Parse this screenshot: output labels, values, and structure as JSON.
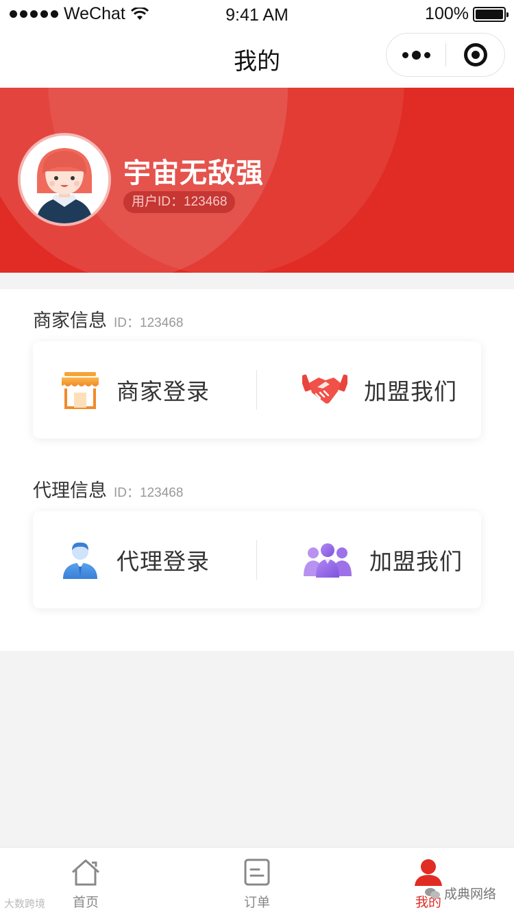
{
  "status_bar": {
    "carrier": "WeChat",
    "time": "9:41 AM",
    "battery": "100%"
  },
  "nav": {
    "title": "我的"
  },
  "profile": {
    "name": "宇宙无敌强",
    "user_id": "用户ID：123468"
  },
  "merchant_section": {
    "title": "商家信息",
    "id_text": "ID：123468",
    "login_label": "商家登录",
    "join_label": "加盟我们"
  },
  "agent_section": {
    "title": "代理信息",
    "id_text": "ID：123468",
    "login_label": "代理登录",
    "join_label": "加盟我们"
  },
  "tab_bar": {
    "tabs": [
      {
        "label": "首页",
        "icon": "home-icon",
        "active": false
      },
      {
        "label": "订单",
        "icon": "order-icon",
        "active": false
      },
      {
        "label": "我的",
        "icon": "user-icon",
        "active": true
      }
    ]
  },
  "watermarks": {
    "left": "大数跨境",
    "right": "成典网络"
  },
  "colors": {
    "primary_red": "#e02c24",
    "store_orange": "#f7a436",
    "agent_blue": "#4a90e2",
    "team_purple": "#9c6ee8"
  }
}
